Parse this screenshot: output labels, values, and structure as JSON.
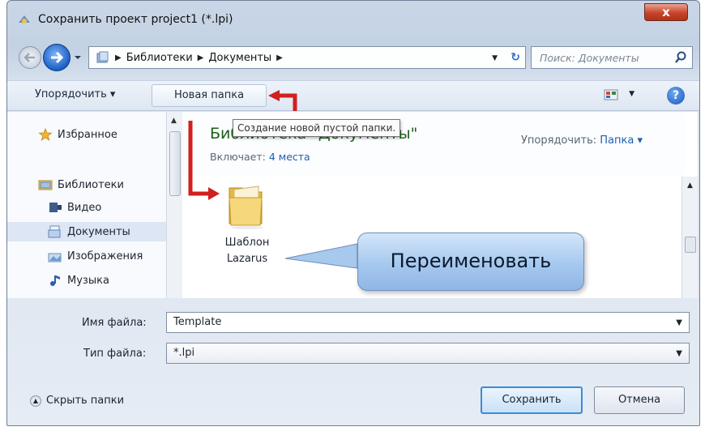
{
  "window": {
    "title": "Сохранить проект project1 (*.lpi)",
    "close_symbol": "x"
  },
  "address": {
    "crumbs": [
      "Библиотеки",
      "Документы"
    ],
    "search_placeholder": "Поиск: Документы"
  },
  "toolbar": {
    "organize_label": "Упорядочить ▾",
    "new_folder_label": "Новая папка",
    "help_symbol": "?"
  },
  "tooltip": "Создание новой пустой папки.",
  "sidebar": {
    "favorites": "Избранное",
    "libraries": "Библиотеки",
    "items": [
      {
        "label": "Видео",
        "icon": "video-icon"
      },
      {
        "label": "Документы",
        "icon": "documents-icon"
      },
      {
        "label": "Изображения",
        "icon": "images-icon"
      },
      {
        "label": "Музыка",
        "icon": "music-icon"
      }
    ]
  },
  "library": {
    "title": "Библиотека \"Документы\"",
    "includes_label": "Включает:",
    "includes_link": "4 места",
    "arrange_label": "Упорядочить:",
    "arrange_value": "Папка ▾"
  },
  "folder": {
    "name_line1": "Шаблон",
    "name_line2": "Lazarus"
  },
  "callout": "Переименовать",
  "form": {
    "filename_label": "Имя файла:",
    "filename_value": "Template",
    "filetype_label": "Тип файла:",
    "filetype_value": "*.lpi"
  },
  "footer": {
    "hide_folders": "Скрыть папки",
    "save_label": "Сохранить",
    "cancel_label": "Отмена"
  },
  "colors": {
    "accent": "#3d8bd6",
    "annotation_arrow": "#d21f1f",
    "library_title": "#1d5e1a"
  }
}
